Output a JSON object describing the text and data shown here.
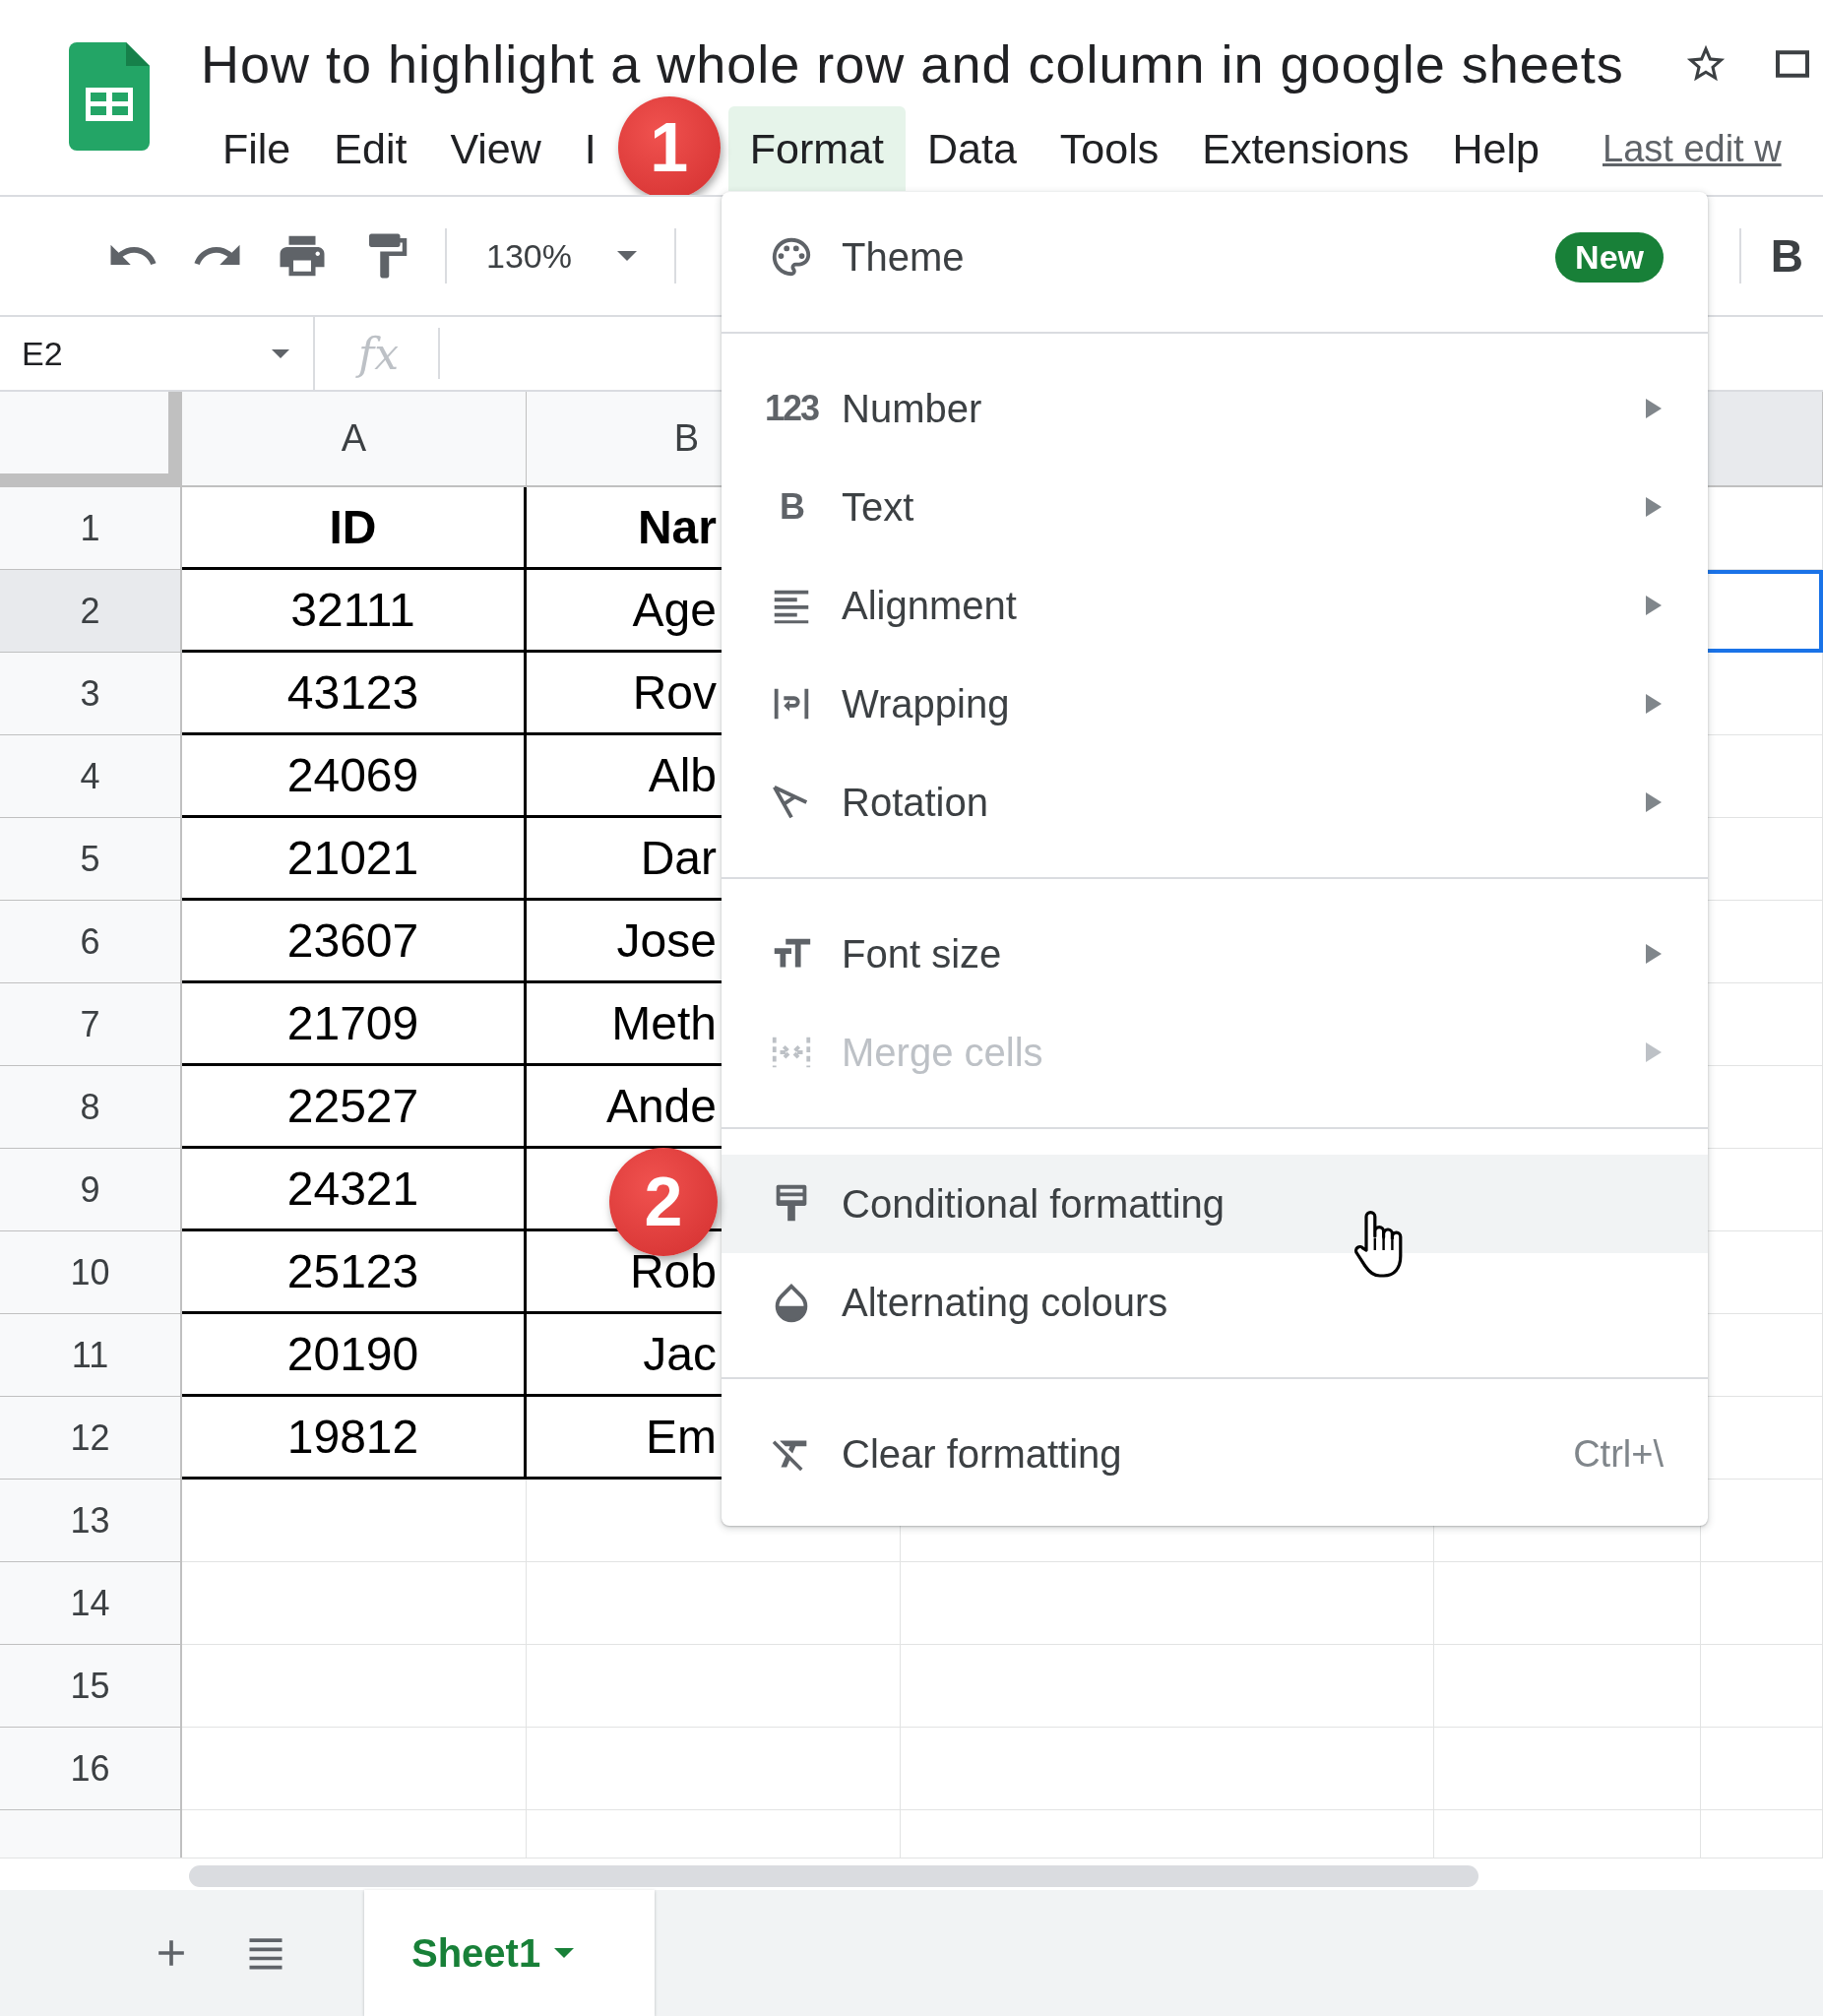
{
  "document": {
    "title": "How to highlight a whole row and column in google sheets",
    "starred": false
  },
  "menubar": [
    {
      "label": "File",
      "selected": false
    },
    {
      "label": "Edit",
      "selected": false
    },
    {
      "label": "View",
      "selected": false
    },
    {
      "label": "I",
      "selected": false
    },
    {
      "label": "Format",
      "selected": true
    },
    {
      "label": "Data",
      "selected": false
    },
    {
      "label": "Tools",
      "selected": false
    },
    {
      "label": "Extensions",
      "selected": false
    },
    {
      "label": "Help",
      "selected": false
    }
  ],
  "last_edit": "Last edit w",
  "toolbar": {
    "zoom": "130%",
    "bold": "B"
  },
  "formula_bar": {
    "name_box": "E2",
    "fx": "fx"
  },
  "columns": [
    {
      "label": "A",
      "selected": false
    },
    {
      "label": "B",
      "selected": false
    },
    {
      "selected": true
    }
  ],
  "rows": [
    {
      "number": "1",
      "kind": "header",
      "selected": false,
      "cells": [
        "ID",
        "Nar"
      ]
    },
    {
      "number": "2",
      "kind": "data",
      "selected": true,
      "cells": [
        "32111",
        "Age"
      ]
    },
    {
      "number": "3",
      "kind": "data",
      "selected": false,
      "cells": [
        "43123",
        "Rov"
      ]
    },
    {
      "number": "4",
      "kind": "data",
      "selected": false,
      "cells": [
        "24069",
        "Alb"
      ]
    },
    {
      "number": "5",
      "kind": "data",
      "selected": false,
      "cells": [
        "21021",
        "Dar"
      ]
    },
    {
      "number": "6",
      "kind": "data",
      "selected": false,
      "cells": [
        "23607",
        "Jose"
      ]
    },
    {
      "number": "7",
      "kind": "data",
      "selected": false,
      "cells": [
        "21709",
        "Meth"
      ]
    },
    {
      "number": "8",
      "kind": "data",
      "selected": false,
      "cells": [
        "22527",
        "Ande"
      ]
    },
    {
      "number": "9",
      "kind": "data",
      "selected": false,
      "cells": [
        "24321"
      ]
    },
    {
      "number": "10",
      "kind": "data",
      "selected": false,
      "cells": [
        "25123",
        "Rob"
      ]
    },
    {
      "number": "11",
      "kind": "data",
      "selected": false,
      "cells": [
        "20190",
        "Jac"
      ]
    },
    {
      "number": "12",
      "kind": "data",
      "selected": false,
      "cells": [
        "19812",
        "Em"
      ]
    },
    {
      "number": "13",
      "kind": "empty",
      "selected": false
    },
    {
      "number": "14",
      "kind": "empty",
      "selected": false
    },
    {
      "number": "15",
      "kind": "empty",
      "selected": false
    },
    {
      "number": "16",
      "kind": "empty",
      "selected": false
    }
  ],
  "format_menu": [
    {
      "kind": "item",
      "label": "Theme",
      "badge": "New",
      "submenu": false,
      "disabled": false,
      "highlighted": false
    },
    {
      "kind": "separator"
    },
    {
      "kind": "item",
      "label": "Number",
      "glyph": "123",
      "submenu": true,
      "disabled": false,
      "highlighted": false
    },
    {
      "kind": "item",
      "label": "Text",
      "glyph": "B",
      "submenu": true,
      "disabled": false,
      "highlighted": false
    },
    {
      "kind": "item",
      "label": "Alignment",
      "submenu": true,
      "disabled": false,
      "highlighted": false
    },
    {
      "kind": "item",
      "label": "Wrapping",
      "submenu": true,
      "disabled": false,
      "highlighted": false
    },
    {
      "kind": "item",
      "label": "Rotation",
      "submenu": true,
      "disabled": false,
      "highlighted": false
    },
    {
      "kind": "separator"
    },
    {
      "kind": "item",
      "label": "Font size",
      "submenu": true,
      "disabled": false,
      "highlighted": false
    },
    {
      "kind": "item",
      "label": "Merge cells",
      "submenu": true,
      "disabled": true,
      "highlighted": false
    },
    {
      "kind": "separator"
    },
    {
      "kind": "item",
      "label": "Conditional formatting",
      "submenu": false,
      "disabled": false,
      "highlighted": true
    },
    {
      "kind": "item",
      "label": "Alternating colours",
      "submenu": false,
      "disabled": false,
      "highlighted": false
    },
    {
      "kind": "separator"
    },
    {
      "kind": "item",
      "label": "Clear formatting",
      "shortcut": "Ctrl+\\",
      "submenu": false,
      "disabled": false,
      "highlighted": false
    }
  ],
  "step_badges": [
    {
      "label": "1"
    },
    {
      "label": "2"
    }
  ],
  "sheet_tabs": [
    {
      "label": "Sheet1",
      "selected": true
    }
  ]
}
